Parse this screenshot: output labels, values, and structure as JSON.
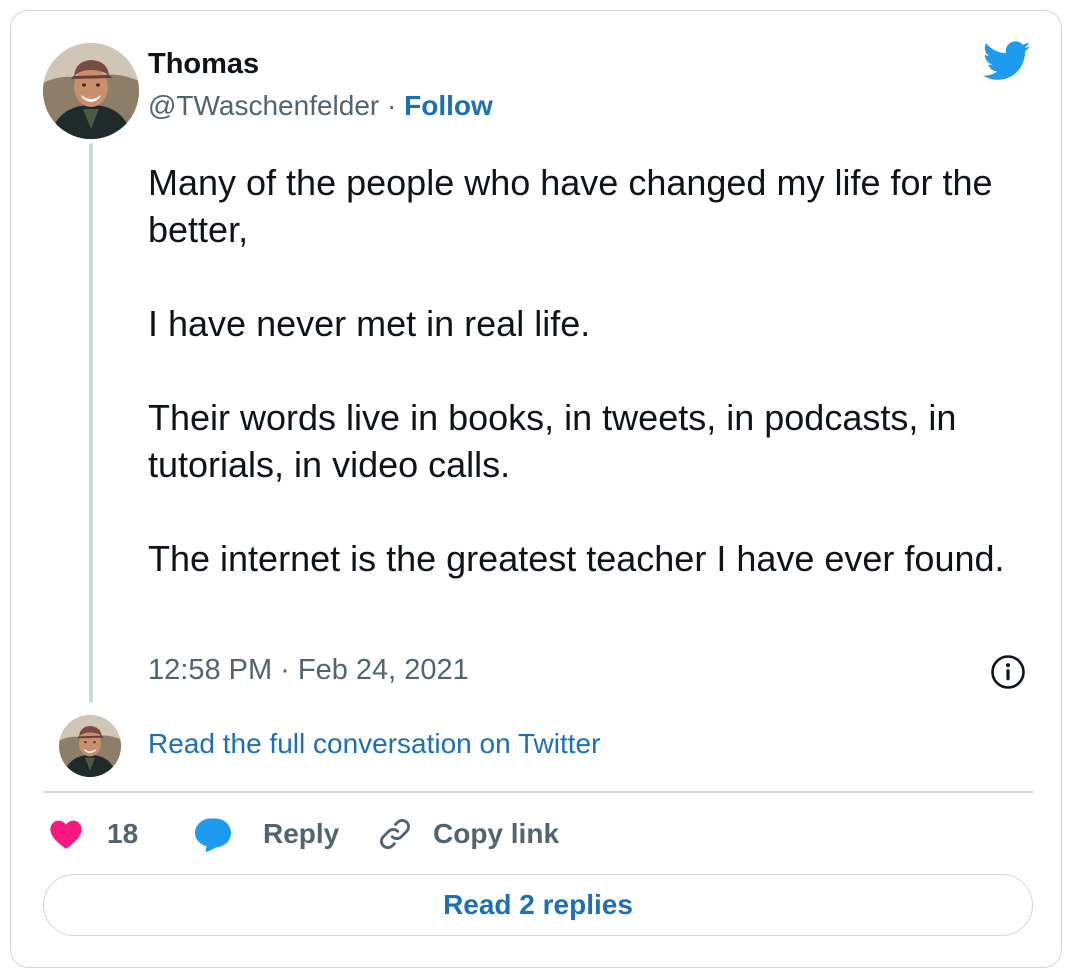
{
  "author": {
    "name": "Thomas",
    "handle": "@TWaschenfelder",
    "separator": "·",
    "follow_label": "Follow"
  },
  "tweet": {
    "paragraphs": [
      "Many of the people who have changed my life for the better,",
      "I have never met in real life.",
      "Their words live in books, in tweets, in podcasts, in tutorials, in video calls.",
      "The internet is the greatest teacher I have ever found."
    ],
    "timestamp": "12:58 PM · Feb 24, 2021"
  },
  "conversation": {
    "read_full_label": "Read the full conversation on Twitter"
  },
  "actions": {
    "like_count": "18",
    "reply_label": "Reply",
    "copy_link_label": "Copy link"
  },
  "footer": {
    "read_replies_label": "Read 2 replies"
  },
  "icons": {
    "brand": "twitter-bird-icon",
    "info": "info-icon",
    "like": "heart-icon",
    "reply": "speech-bubble-icon",
    "copy": "link-icon"
  },
  "colors": {
    "link": "#1d6fb8",
    "twitter_blue": "#1d9bf0",
    "heart": "#f91880",
    "muted": "#536471",
    "border": "#cfd9de"
  }
}
